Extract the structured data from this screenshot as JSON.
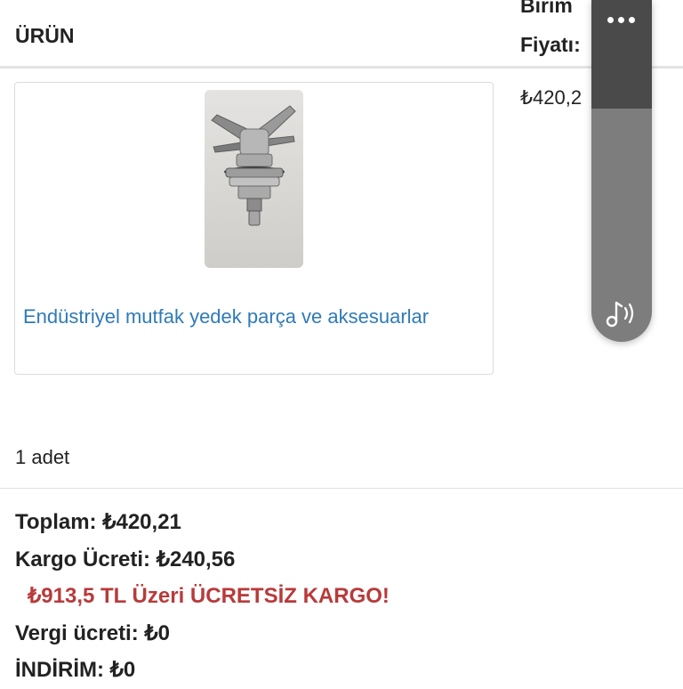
{
  "table": {
    "col_product": "ÜRÜN",
    "col_unit_price_line1": "Birim",
    "col_unit_price_line2": "Fiyatı:"
  },
  "item": {
    "name": "Endüstriyel mutfak yedek parça ve aksesuarlar",
    "unit_price": "₺420,2",
    "quantity": "1 adet"
  },
  "summary": {
    "total": "Toplam: ₺420,21",
    "shipping": "Kargo Ücreti: ₺240,56",
    "free_shipping_note": "₺913,5 TL Üzeri ÜCRETSİZ KARGO!",
    "tax": "Vergi ücreti: ₺0",
    "discount": "İNDİRİM: ₺0"
  },
  "overlay": {
    "menu_icon": "more-dots-icon",
    "audio_icon": "music-note-sound-icon"
  },
  "colors": {
    "link": "#2f7ab8",
    "promo": "#b83a3a",
    "overlay_dark": "#4a4a4a",
    "overlay_light": "#7d7d7d"
  }
}
